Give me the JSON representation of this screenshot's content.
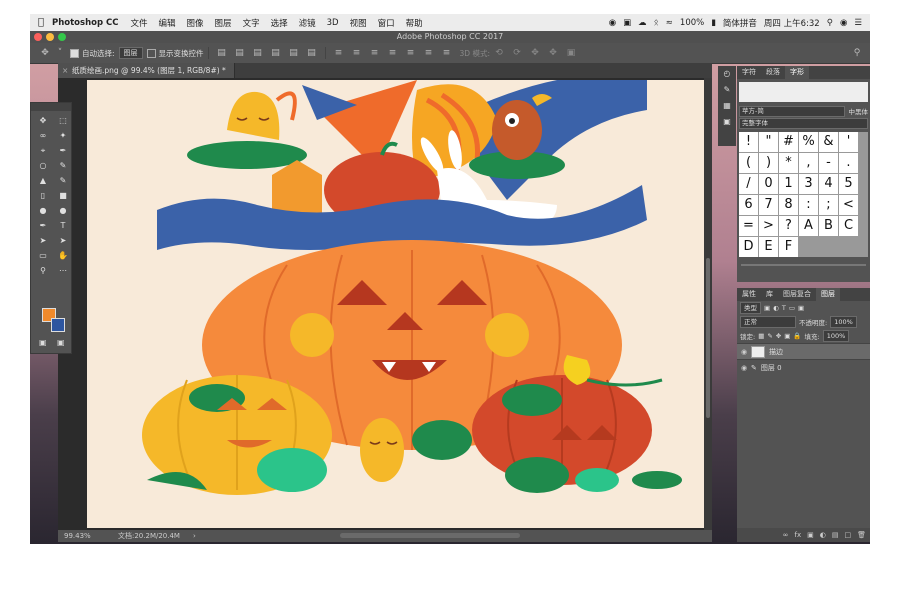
{
  "menubar": {
    "app_name": "Photoshop CC",
    "items": [
      "文件",
      "编辑",
      "图像",
      "图层",
      "文字",
      "选择",
      "滤镜",
      "3D",
      "视图",
      "窗口",
      "帮助"
    ],
    "battery": "100%",
    "input_method": "简体拼音",
    "clock": "周四 上午6:32"
  },
  "window": {
    "title": "Adobe Photoshop CC 2017"
  },
  "options": {
    "auto_select_label": "自动选择:",
    "auto_select_value": "图层",
    "show_transform_label": "显示变换控件",
    "mode_3d_label": "3D 模式:"
  },
  "document": {
    "tab_label": "纸质绘画.png @ 99.4% (图层 1, RGB/8#) *"
  },
  "status": {
    "zoom": "99.43%",
    "doc_size": "文档:20.2M/20.4M",
    "arrow": "›"
  },
  "colors": {
    "foreground": "#f08a2c",
    "background": "#2e56a0",
    "canvas": "#f8ead9"
  },
  "character_panel": {
    "tabs": [
      "字符",
      "段落",
      "字形"
    ],
    "active_tab": "字形",
    "font_family": "苹方-简",
    "font_style": "中黑体",
    "glyph_set": "完整字体",
    "glyphs": [
      "!",
      "\"",
      "#",
      "%",
      "&",
      "'",
      "(",
      ")",
      "*",
      ",",
      "-",
      ".",
      "/",
      "0",
      "1",
      "3",
      "4",
      "5",
      "6",
      "7",
      "8",
      ":",
      ";",
      "<",
      "=",
      ">",
      "?",
      "A",
      "B",
      "C",
      "D",
      "E",
      "F"
    ]
  },
  "layers_panel": {
    "tabs": [
      "属性",
      "库",
      "图层复合",
      "图层"
    ],
    "active_tab": "图层",
    "kind_filter": "类型",
    "blend_mode": "正常",
    "opacity_label": "不透明度:",
    "opacity_value": "100%",
    "lock_label": "锁定:",
    "fill_label": "填充:",
    "fill_value": "100%",
    "layers": [
      {
        "name": "描边",
        "selected": true
      },
      {
        "name": "图层 0",
        "selected": false
      }
    ]
  },
  "icons": [
    "apple-icon",
    "move-tool-icon",
    "marquee-tool-icon",
    "lasso-tool-icon",
    "magic-wand-icon",
    "crop-icon",
    "eyedropper-icon",
    "brush-icon",
    "stamp-icon",
    "eraser-icon",
    "gradient-icon",
    "blur-icon",
    "dodge-icon",
    "pen-icon",
    "type-icon",
    "path-select-icon",
    "shape-icon",
    "hand-icon",
    "zoom-icon",
    "search-icon",
    "eye-icon",
    "fx-icon",
    "trash-icon"
  ]
}
